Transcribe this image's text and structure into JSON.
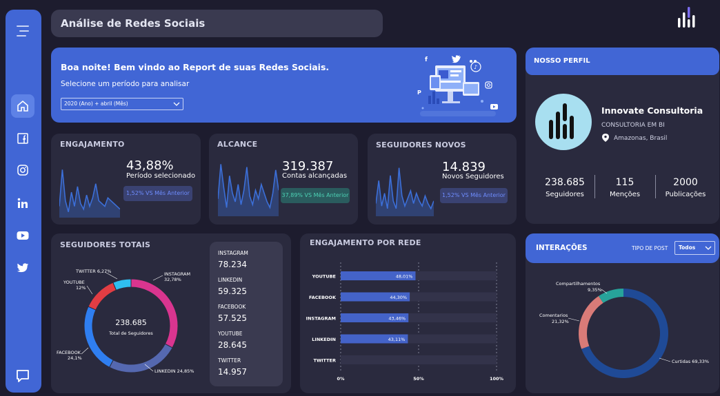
{
  "header": {
    "title": "Análise de Redes Sociais"
  },
  "welcome": {
    "greeting": "Boa noite! Bem vindo ao Report de suas Redes Sociais.",
    "prompt": "Selecione um período para analisar",
    "period_value": "2020 (Ano) + abril (Mês)"
  },
  "kpis": [
    {
      "title": "ENGAJAMENTO",
      "value": "43,88%",
      "caption": "Período selecionado",
      "comparison": "1,52% VS Mês Anterior",
      "color": "#4a7cf0"
    },
    {
      "title": "ALCANCE",
      "value": "319.387",
      "caption": "Contas alcançadas",
      "comparison": "37,89% VS Mês Anterior",
      "color": "#2aa594"
    },
    {
      "title": "SEGUIDORES NOVOS",
      "value": "14.839",
      "caption": "Novos Seguidores",
      "comparison": "1,52% VS Mês Anterior",
      "color": "#4a7cf0"
    }
  ],
  "profile": {
    "section_title": "NOSSO PERFIL",
    "name": "Innovate Consultoria",
    "subtitle": "CONSULTORIA EM BI",
    "location": "Amazonas, Brasil",
    "stats": [
      {
        "value": "238.685",
        "label": "Seguidores"
      },
      {
        "value": "115",
        "label": "Menções"
      },
      {
        "value": "2000",
        "label": "Publicações"
      }
    ]
  },
  "followers": {
    "title": "SEGUIDORES TOTAIS",
    "center_value": "238.685",
    "center_label": "Total de Seguidores",
    "list": [
      {
        "network": "INSTAGRAM",
        "value": "78.234"
      },
      {
        "network": "LINKEDIN",
        "value": "59.325"
      },
      {
        "network": "FACEBOOK",
        "value": "57.525"
      },
      {
        "network": "YOUTUBE",
        "value": "28.645"
      },
      {
        "network": "TWITTER",
        "value": "14.957"
      }
    ]
  },
  "engagement_by_network": {
    "title": "ENGAJAMENTO POR REDE"
  },
  "interactions": {
    "title": "INTERAÇÕES",
    "filter_label": "TIPO DE POST",
    "filter_value": "Todos"
  },
  "chart_data": [
    {
      "type": "pie",
      "title": "SEGUIDORES TOTAIS",
      "labels": [
        "INSTAGRAM",
        "LINKEDIN",
        "FACEBOOK",
        "YOUTUBE",
        "TWITTER"
      ],
      "values": [
        32.78,
        24.85,
        24.1,
        12,
        6.27
      ],
      "value_labels": [
        "32,78%",
        "LINKEDIN 24,85%",
        "24,1%",
        "12%",
        "TWITTER 6,27%"
      ],
      "colors": [
        "#d9358f",
        "#5568b0",
        "#2f7ef0",
        "#e23d43",
        "#2fbff0"
      ]
    },
    {
      "type": "bar",
      "title": "ENGAJAMENTO POR REDE",
      "categories": [
        "YOUTUBE",
        "FACEBOOK",
        "INSTAGRAM",
        "LINKEDIN",
        "TWITTER"
      ],
      "values": [
        48.01,
        44.3,
        43.46,
        43.11,
        0
      ],
      "value_labels": [
        "48,01%",
        "44,30%",
        "43,46%",
        "43,11%",
        ""
      ],
      "xlim": [
        0,
        100
      ],
      "xticks": [
        "0%",
        "50%",
        "100%"
      ],
      "color": "#4463c8"
    },
    {
      "type": "pie",
      "title": "INTERAÇÕES",
      "labels": [
        "Curtidas",
        "Comentarios",
        "Compartilhamentos"
      ],
      "values": [
        69.33,
        21.32,
        9.35
      ],
      "value_labels": [
        "69,33%",
        "21,32%",
        "9,35%"
      ],
      "colors": [
        "#1f4a96",
        "#d97b78",
        "#27a39a"
      ]
    },
    {
      "type": "area",
      "title": "ENGAJAMENTO",
      "values": [
        20,
        85,
        30,
        10,
        45,
        20,
        55,
        25,
        15,
        40,
        20,
        35,
        60,
        30,
        25,
        20,
        35,
        30,
        25,
        20,
        15
      ],
      "color": "#3c6fd8"
    },
    {
      "type": "area",
      "title": "ALCANCE",
      "values": [
        30,
        90,
        50,
        15,
        70,
        40,
        25,
        55,
        20,
        45,
        85,
        35,
        20,
        45,
        30,
        55,
        40,
        25,
        15,
        40,
        80,
        45
      ],
      "color": "#3c6fd8"
    },
    {
      "type": "area",
      "title": "SEGUIDORES NOVOS",
      "values": [
        25,
        70,
        20,
        45,
        15,
        80,
        30,
        15,
        95,
        40,
        20,
        35,
        50,
        25,
        45,
        30,
        20,
        40,
        25,
        15,
        30
      ],
      "color": "#3c6fd8"
    }
  ]
}
